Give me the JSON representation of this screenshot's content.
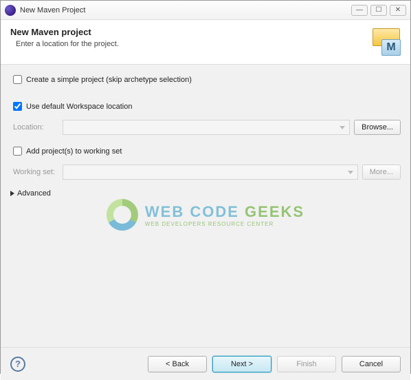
{
  "window": {
    "title": "New Maven Project"
  },
  "header": {
    "title": "New Maven project",
    "subtitle": "Enter a location for the project.",
    "icon_badge": "M"
  },
  "form": {
    "create_simple": {
      "label": "Create a simple project (skip archetype selection)",
      "checked": false
    },
    "use_default_workspace": {
      "label": "Use default Workspace location",
      "checked": true
    },
    "location": {
      "label": "Location:",
      "value": "",
      "browse_label": "Browse..."
    },
    "add_to_working_set": {
      "label": "Add project(s) to working set",
      "checked": false
    },
    "working_set": {
      "label": "Working set:",
      "value": "",
      "more_label": "More..."
    },
    "advanced": {
      "label": "Advanced",
      "expanded": false
    }
  },
  "buttons": {
    "back": "< Back",
    "next": "Next >",
    "finish": "Finish",
    "cancel": "Cancel"
  },
  "watermark": {
    "brand_left": "WEB CODE ",
    "brand_right": "GEEKS",
    "tagline": "WEB DEVELOPERS RESOURCE CENTER"
  }
}
